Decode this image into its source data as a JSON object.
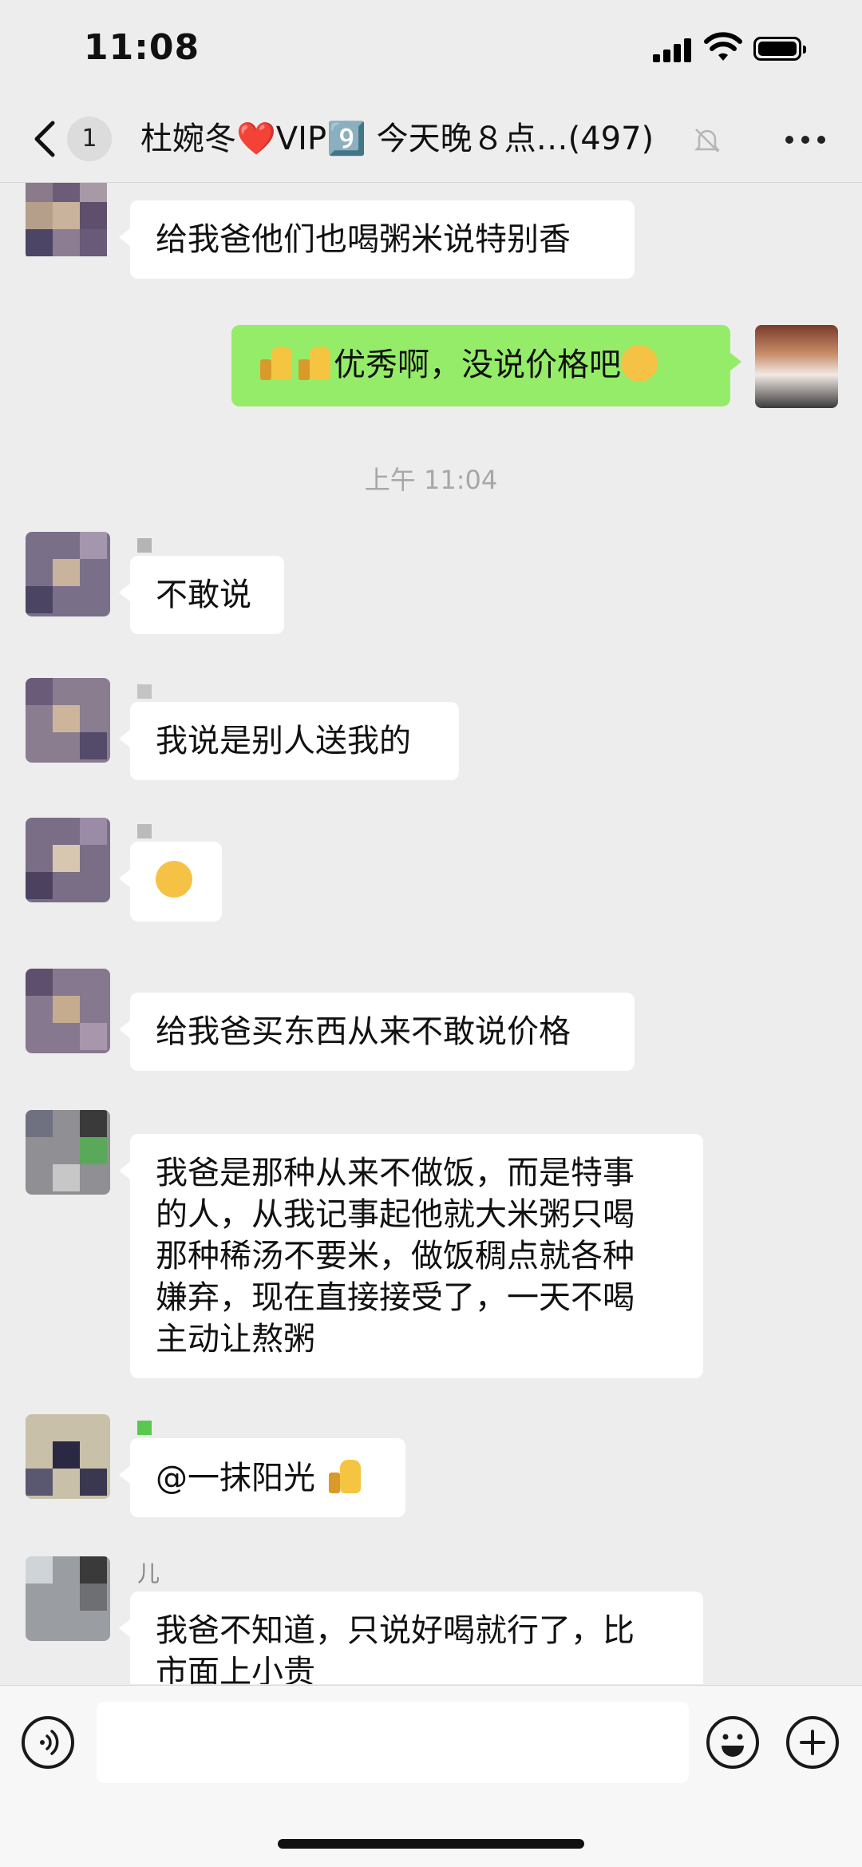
{
  "status": {
    "time": "11:08"
  },
  "header": {
    "unread_count": "1",
    "title": "杜婉冬❤️VIP9️⃣ 今天晚８点…(497)"
  },
  "messages": [
    {
      "side": "left",
      "sender": "",
      "text": "给我爸他们也喝粥米说特别香"
    },
    {
      "side": "right",
      "text": "优秀啊，没说价格吧",
      "emoji_before": [
        "thumbs-up-icon",
        "thumbs-up-icon"
      ],
      "emoji_after": "thinking-face-icon"
    },
    {
      "type": "time",
      "text": "上午 11:04"
    },
    {
      "side": "left",
      "sender": "",
      "text": "不敢说"
    },
    {
      "side": "left",
      "sender": "",
      "text": "我说是别人送我的"
    },
    {
      "side": "left",
      "sender": "",
      "text": "",
      "emoji_only": "laughing-crying-icon"
    },
    {
      "side": "left",
      "sender": "",
      "text": "给我爸买东西从来不敢说价格"
    },
    {
      "side": "left",
      "sender": "",
      "lines": [
        "我爸是那种从来不做饭，而是特事",
        "的人，从我记事起他就大米粥只喝",
        "那种稀汤不要米，做饭稠点就各种",
        "嫌弃，现在直接接受了，一天不喝",
        "主动让熬粥"
      ]
    },
    {
      "side": "left",
      "sender": "",
      "text": "@一抹阳光 ",
      "emoji_after": "thumbs-up-icon"
    },
    {
      "side": "left",
      "sender": "儿",
      "lines": [
        "我爸不知道，只说好喝就行了，比",
        "市面上小贵"
      ]
    }
  ],
  "input": {
    "voice_icon": "voice-icon",
    "emoji_icon": "emoji-icon",
    "add_icon": "add-icon"
  },
  "colors": {
    "bg": "#ededed",
    "self_bubble": "#95ec69",
    "other_bubble": "#ffffff"
  }
}
